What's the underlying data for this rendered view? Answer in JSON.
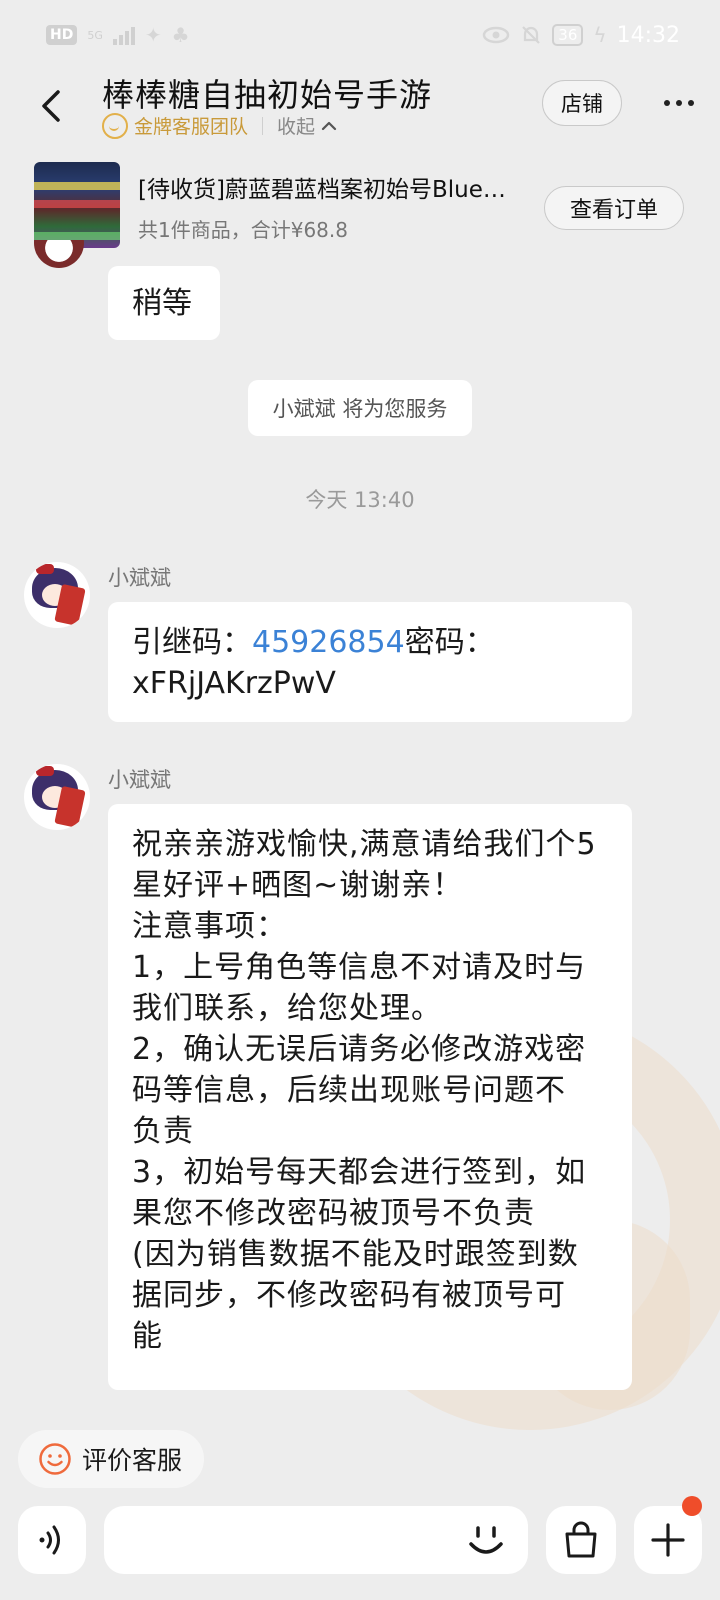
{
  "status_bar": {
    "left_badge": "HD",
    "network": "5G",
    "time": "14:32",
    "battery": "36"
  },
  "header": {
    "title": "棒棒糖自抽初始号手游",
    "team_label": "金牌客服团队",
    "collapse_label": "收起",
    "shop_label": "店铺"
  },
  "order": {
    "title": "[待收货]蔚蓝碧蓝档案初始号Blue…",
    "meta": "共1件商品，合计¥68.8",
    "view_label": "查看订单"
  },
  "chat": {
    "wait_message": "稍等",
    "service_notice": "小斌斌 将为您服务",
    "time_divider": "今天  13:40",
    "messages": [
      {
        "sender": "小斌斌",
        "prefix": "引继码：",
        "code": "45926854",
        "suffix": "密码：",
        "line2": "xFRjJAKrzPwV"
      },
      {
        "sender": "小斌斌",
        "lines": [
          "祝亲亲游戏愉快,满意请给我们个5",
          "星好评+晒图~谢谢亲！",
          "注意事项：",
          "1，上号角色等信息不对请及时与",
          "我们联系，给您处理。",
          "2，确认无误后请务必修改游戏密",
          "码等信息，后续出现账号问题不",
          "负责",
          "3，初始号每天都会进行签到，如",
          "果您不修改密码被顶号不负责",
          "(因为销售数据不能及时跟签到数",
          "据同步，不修改密码有被顶号可",
          "能"
        ]
      }
    ]
  },
  "bottom": {
    "rate_label": "评价客服",
    "accent_color": "#ef6a3c"
  }
}
